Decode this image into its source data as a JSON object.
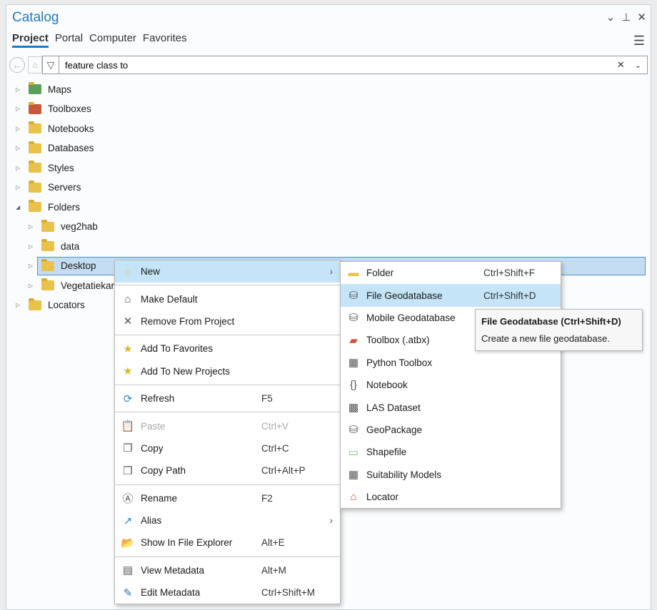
{
  "pane": {
    "title": "Catalog",
    "controls": [
      "⌄",
      "⊥",
      "✕"
    ]
  },
  "tabs": [
    "Project",
    "Portal",
    "Computer",
    "Favorites"
  ],
  "active_tab": "Project",
  "search": {
    "value": "feature class to"
  },
  "tree": [
    {
      "label": "Maps",
      "level": 0,
      "expanded": false,
      "icon": "maps-icon"
    },
    {
      "label": "Toolboxes",
      "level": 0,
      "expanded": false,
      "icon": "toolboxes-icon"
    },
    {
      "label": "Notebooks",
      "level": 0,
      "expanded": false,
      "icon": "notebooks-icon"
    },
    {
      "label": "Databases",
      "level": 0,
      "expanded": false,
      "icon": "databases-icon"
    },
    {
      "label": "Styles",
      "level": 0,
      "expanded": false,
      "icon": "styles-icon"
    },
    {
      "label": "Servers",
      "level": 0,
      "expanded": false,
      "icon": "servers-icon"
    },
    {
      "label": "Folders",
      "level": 0,
      "expanded": true,
      "icon": "folders-icon"
    },
    {
      "label": "veg2hab",
      "level": 1,
      "expanded": false,
      "icon": "folder-home-icon"
    },
    {
      "label": "data",
      "level": 1,
      "expanded": false,
      "icon": "folder-icon"
    },
    {
      "label": "Desktop",
      "level": 1,
      "expanded": false,
      "icon": "folder-icon",
      "selected": true
    },
    {
      "label": "Vegetatiekart",
      "level": 1,
      "expanded": false,
      "icon": "folder-icon"
    },
    {
      "label": "Locators",
      "level": 0,
      "expanded": false,
      "icon": "locators-icon"
    }
  ],
  "context_menu": [
    {
      "label": "New",
      "icon": "new-icon",
      "glyph": "☼",
      "submenu": true,
      "highlighted": true
    },
    {
      "sep": true
    },
    {
      "label": "Make Default",
      "icon": "home-icon",
      "glyph": "⌂"
    },
    {
      "label": "Remove From Project",
      "icon": "close-icon",
      "glyph": "✕"
    },
    {
      "sep": true
    },
    {
      "label": "Add To Favorites",
      "icon": "star-icon",
      "glyph": "★"
    },
    {
      "label": "Add To New Projects",
      "icon": "star-pin-icon",
      "glyph": "★"
    },
    {
      "sep": true
    },
    {
      "label": "Refresh",
      "icon": "refresh-icon",
      "glyph": "⟳",
      "shortcut": "F5"
    },
    {
      "sep": true
    },
    {
      "label": "Paste",
      "icon": "paste-icon",
      "glyph": "📋",
      "shortcut": "Ctrl+V",
      "disabled": true
    },
    {
      "label": "Copy",
      "icon": "copy-icon",
      "glyph": "❐",
      "shortcut": "Ctrl+C"
    },
    {
      "label": "Copy Path",
      "icon": "copy-path-icon",
      "glyph": "❐",
      "shortcut": "Ctrl+Alt+P"
    },
    {
      "sep": true
    },
    {
      "label": "Rename",
      "icon": "rename-icon",
      "glyph": "Ⓐ",
      "shortcut": "F2"
    },
    {
      "label": "Alias",
      "icon": "alias-icon",
      "glyph": "↗",
      "submenu": true
    },
    {
      "label": "Show In File Explorer",
      "icon": "folder-open-icon",
      "glyph": "📂",
      "shortcut": "Alt+E"
    },
    {
      "sep": true
    },
    {
      "label": "View Metadata",
      "icon": "metadata-icon",
      "glyph": "▤",
      "shortcut": "Alt+M"
    },
    {
      "label": "Edit Metadata",
      "icon": "pencil-icon",
      "glyph": "✎",
      "shortcut": "Ctrl+Shift+M"
    }
  ],
  "new_submenu": [
    {
      "label": "Folder",
      "icon": "folder-new-icon",
      "glyph": "▬",
      "shortcut": "Ctrl+Shift+F"
    },
    {
      "label": "File Geodatabase",
      "icon": "file-geodatabase-icon",
      "glyph": "⛁",
      "shortcut": "Ctrl+Shift+D",
      "highlighted": true
    },
    {
      "label": "Mobile Geodatabase",
      "icon": "mobile-geodatabase-icon",
      "glyph": "⛁"
    },
    {
      "label": "Toolbox (.atbx)",
      "icon": "toolbox-icon",
      "glyph": "▰"
    },
    {
      "label": "Python Toolbox",
      "icon": "python-toolbox-icon",
      "glyph": "▦"
    },
    {
      "label": "Notebook",
      "icon": "notebook-icon",
      "glyph": "{}"
    },
    {
      "label": "LAS Dataset",
      "icon": "las-dataset-icon",
      "glyph": "▩"
    },
    {
      "label": "GeoPackage",
      "icon": "geopackage-icon",
      "glyph": "⛁"
    },
    {
      "label": "Shapefile",
      "icon": "shapefile-icon",
      "glyph": "▭"
    },
    {
      "label": "Suitability Models",
      "icon": "suitability-models-icon",
      "glyph": "▦"
    },
    {
      "label": "Locator",
      "icon": "locator-icon",
      "glyph": "⌂"
    }
  ],
  "tooltip": {
    "title": "File Geodatabase (Ctrl+Shift+D)",
    "body": "Create a new file geodatabase."
  },
  "colors": {
    "accent": "#1f78c1",
    "selection": "#c5ddf2",
    "menu_highlight": "#c5e4f7"
  }
}
